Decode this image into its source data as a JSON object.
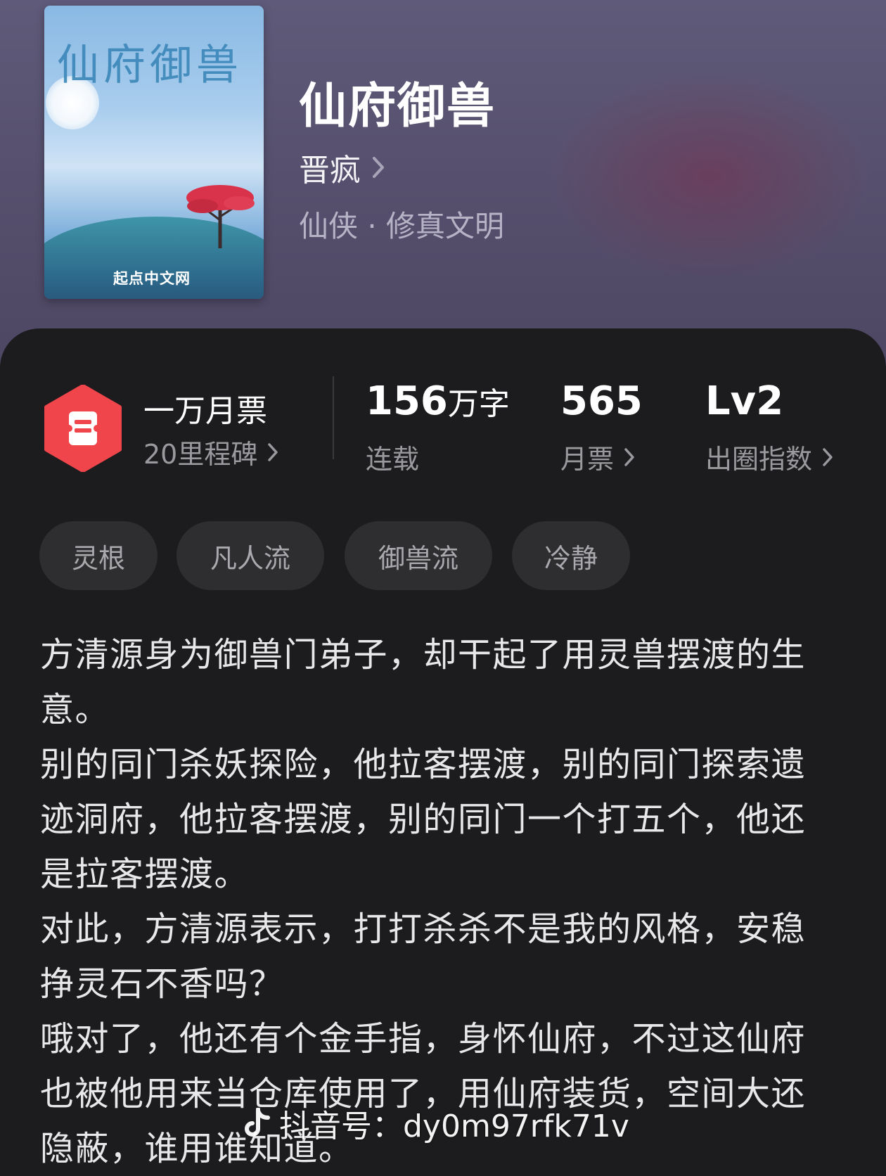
{
  "book": {
    "cover": {
      "title_art": "仙府御兽",
      "publisher": "起点中文网"
    },
    "title": "仙府御兽",
    "author": "晋疯",
    "genre": "仙侠 · 修真文明"
  },
  "stats": {
    "award_title": "一万月票",
    "award_sub": "20里程碑",
    "word_count_value": "156",
    "word_count_unit": "万字",
    "word_count_label": "连载",
    "monthly_ticket_value": "565",
    "monthly_ticket_label": "月票",
    "popularity_value": "Lv2",
    "popularity_label": "出圈指数"
  },
  "tags": [
    "灵根",
    "凡人流",
    "御兽流",
    "冷静"
  ],
  "description": [
    "方清源身为御兽门弟子，却干起了用灵兽摆渡的生意。",
    "别的同门杀妖探险，他拉客摆渡，别的同门探索遗迹洞府，他拉客摆渡，别的同门一个打五个，他还是拉客摆渡。",
    "对此，方清源表示，打打杀杀不是我的风格，安稳挣灵石不香吗？",
    "哦对了，他还有个金手指，身怀仙府，不过这仙府也被他用来当仓库使用了，用仙府装货，空间大还隐蔽，谁用谁知道。"
  ],
  "watermark": "抖音号：dy0m97rfk71v",
  "colors": {
    "award_red": "#f0454b",
    "panel_bg": "#1c1c1e",
    "hero_bg": "#5a5473"
  }
}
